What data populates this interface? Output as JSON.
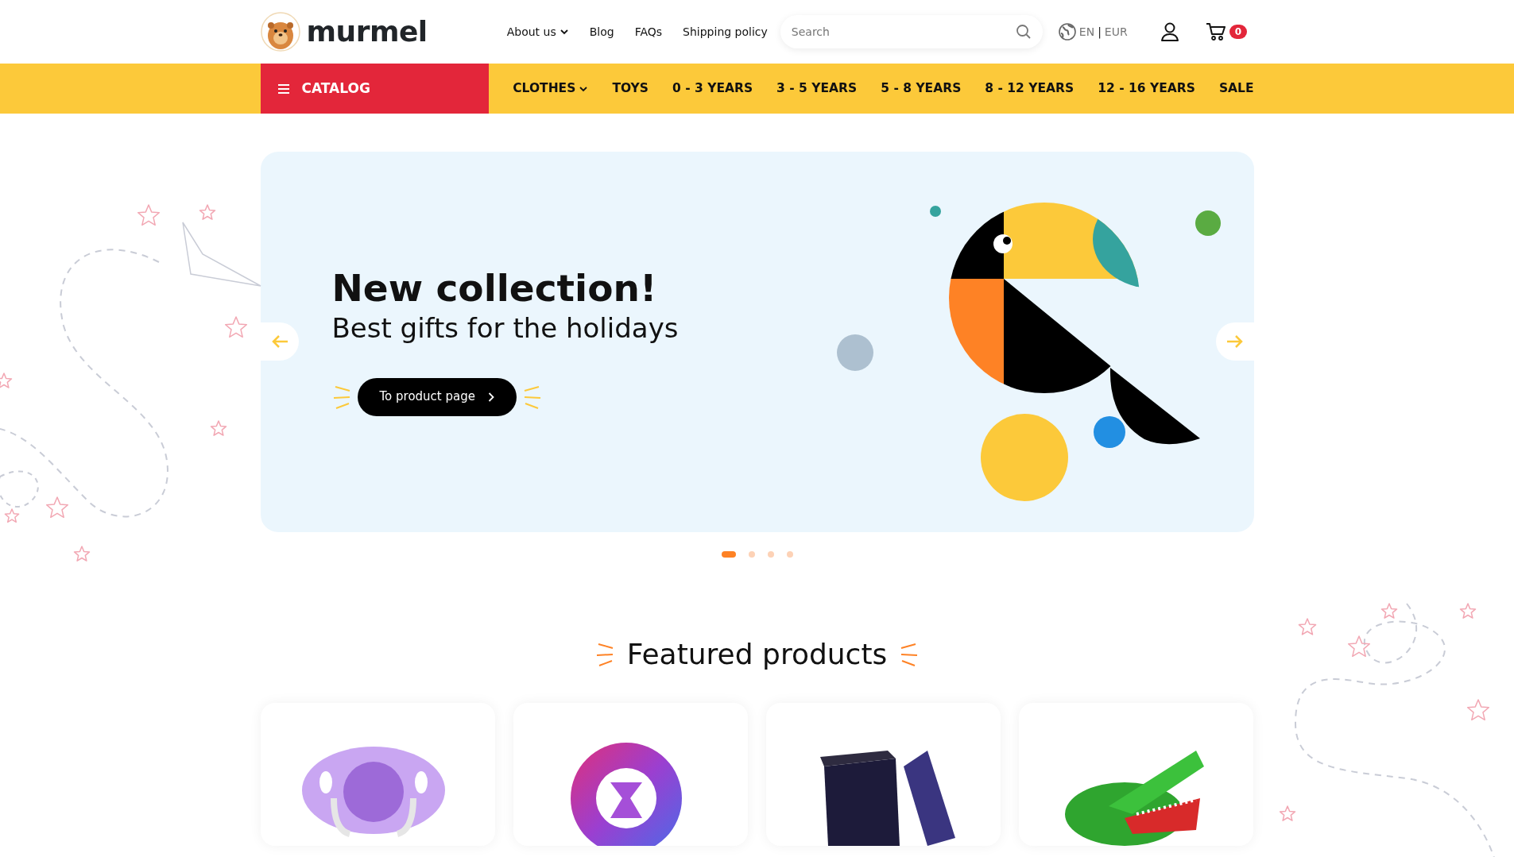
{
  "logo": {
    "text": "murmel"
  },
  "top_links": [
    {
      "label": "About us",
      "has_dropdown": true
    },
    {
      "label": "Blog",
      "has_dropdown": false
    },
    {
      "label": "FAQs",
      "has_dropdown": false
    },
    {
      "label": "Shipping policy",
      "has_dropdown": false
    }
  ],
  "search": {
    "placeholder": "Search"
  },
  "locale": {
    "language": "EN",
    "separator": "|",
    "currency": "EUR"
  },
  "cart": {
    "count": "0"
  },
  "catalog": {
    "label": "CATALOG"
  },
  "categories": [
    {
      "label": "CLOTHES",
      "has_dropdown": true
    },
    {
      "label": "TOYS",
      "has_dropdown": false
    },
    {
      "label": "0 - 3 YEARS",
      "has_dropdown": false
    },
    {
      "label": "3 - 5 YEARS",
      "has_dropdown": false
    },
    {
      "label": "5 - 8 YEARS",
      "has_dropdown": false
    },
    {
      "label": "8 - 12 YEARS",
      "has_dropdown": false
    },
    {
      "label": "12 - 16 YEARS",
      "has_dropdown": false
    },
    {
      "label": "SALE",
      "has_dropdown": false
    }
  ],
  "hero": {
    "title": "New collection!",
    "subtitle": "Best gifts for the holidays",
    "button": "To product page"
  },
  "carousel_dots": [
    {
      "selected": true
    },
    {
      "selected": false
    },
    {
      "selected": false
    },
    {
      "selected": false
    }
  ],
  "featured": {
    "title": "Featured products"
  },
  "products": [
    {
      "kind": "pacifier"
    },
    {
      "kind": "ring"
    },
    {
      "kind": "gift-box"
    },
    {
      "kind": "crocodile"
    }
  ]
}
